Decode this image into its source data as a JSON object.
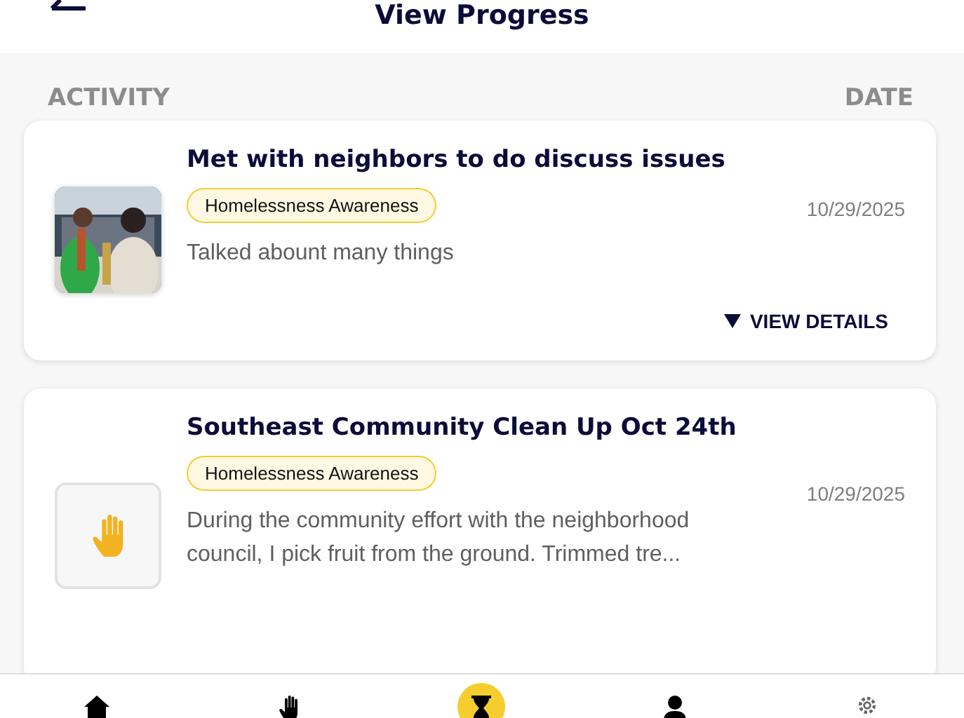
{
  "header": {
    "title": "View Progress"
  },
  "columns": [
    "ACTIVITY",
    "DATE"
  ],
  "activities": [
    {
      "kind": "picture",
      "title": "Met with neighbors to do discuss issues",
      "tag": "Homelessness Awareness",
      "date": "10/29/2025",
      "description": "Talked abount many things",
      "action": "VIEW DETAILS"
    },
    {
      "kind": "icon",
      "title": "Southeast Community Clean Up Oct 24th",
      "tag": "Homelessness Awareness",
      "date": "10/29/2025",
      "description": "During the community effort with the neighborhood council, I pick fruit from the ground. Trimmed tre..."
    }
  ],
  "nav": [
    {
      "selected": false
    },
    {
      "selected": false
    },
    {
      "selected": true
    },
    {
      "selected": false
    },
    {
      "selected": false
    }
  ]
}
